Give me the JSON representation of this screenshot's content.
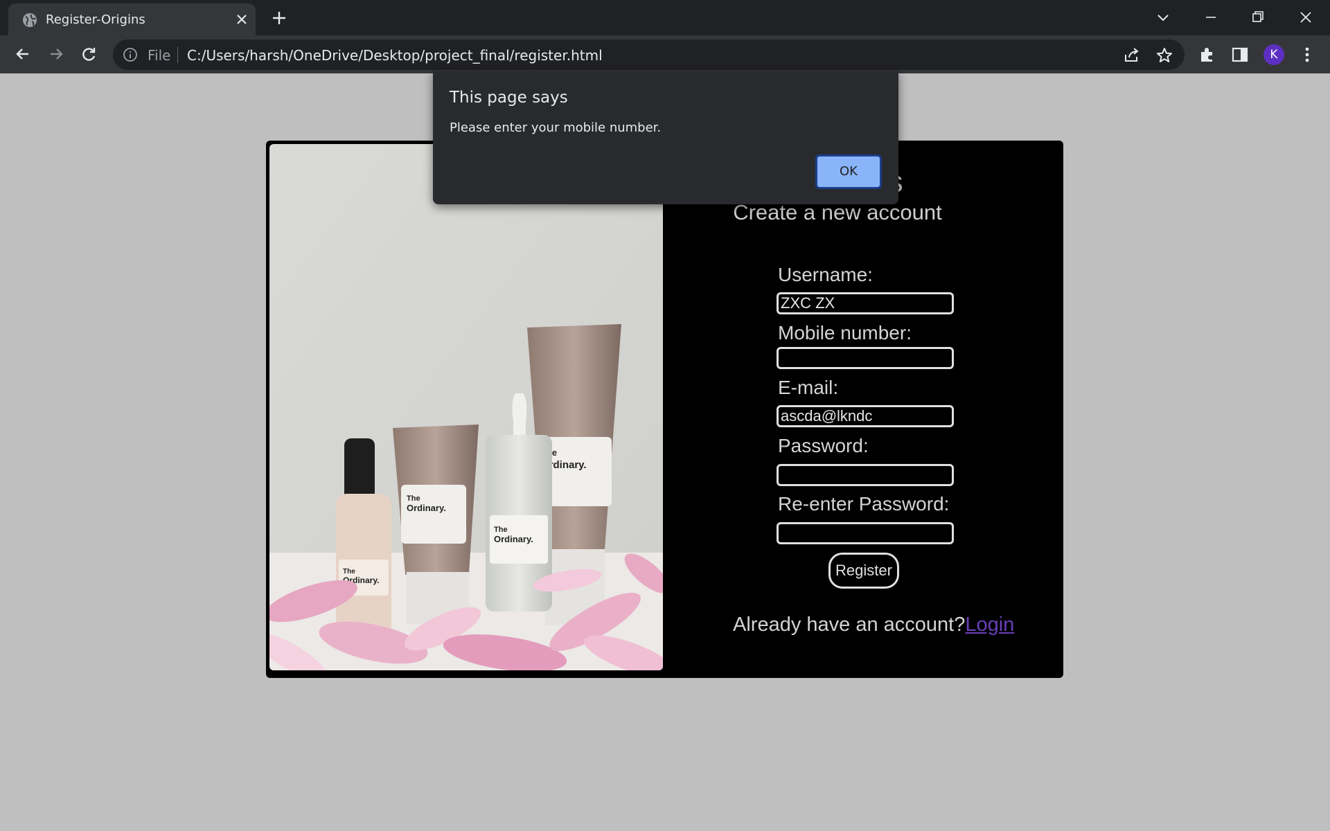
{
  "browser": {
    "tab_title": "Register-Origins",
    "address_scheme": "File",
    "address_url": "C:/Users/harsh/OneDrive/Desktop/project_final/register.html",
    "profile_initial": "K",
    "accent": "#8ab4f8"
  },
  "page": {
    "brand": "Origins",
    "subtitle": "Create a new account",
    "form": {
      "username_label": "Username:",
      "username_value": "ZXC ZX",
      "mobile_label": "Mobile number:",
      "mobile_value": "",
      "email_label": "E-mail:",
      "email_value": "ascda@lkndc",
      "password_label": "Password:",
      "password_value": "",
      "reenter_label": "Re-enter Password:",
      "reenter_value": "",
      "register_label": "Register"
    },
    "login_prompt": "Already have an account?",
    "login_link": "Login"
  },
  "alert": {
    "title": "This page says",
    "message": "Please enter your mobile number.",
    "ok_label": "OK"
  }
}
